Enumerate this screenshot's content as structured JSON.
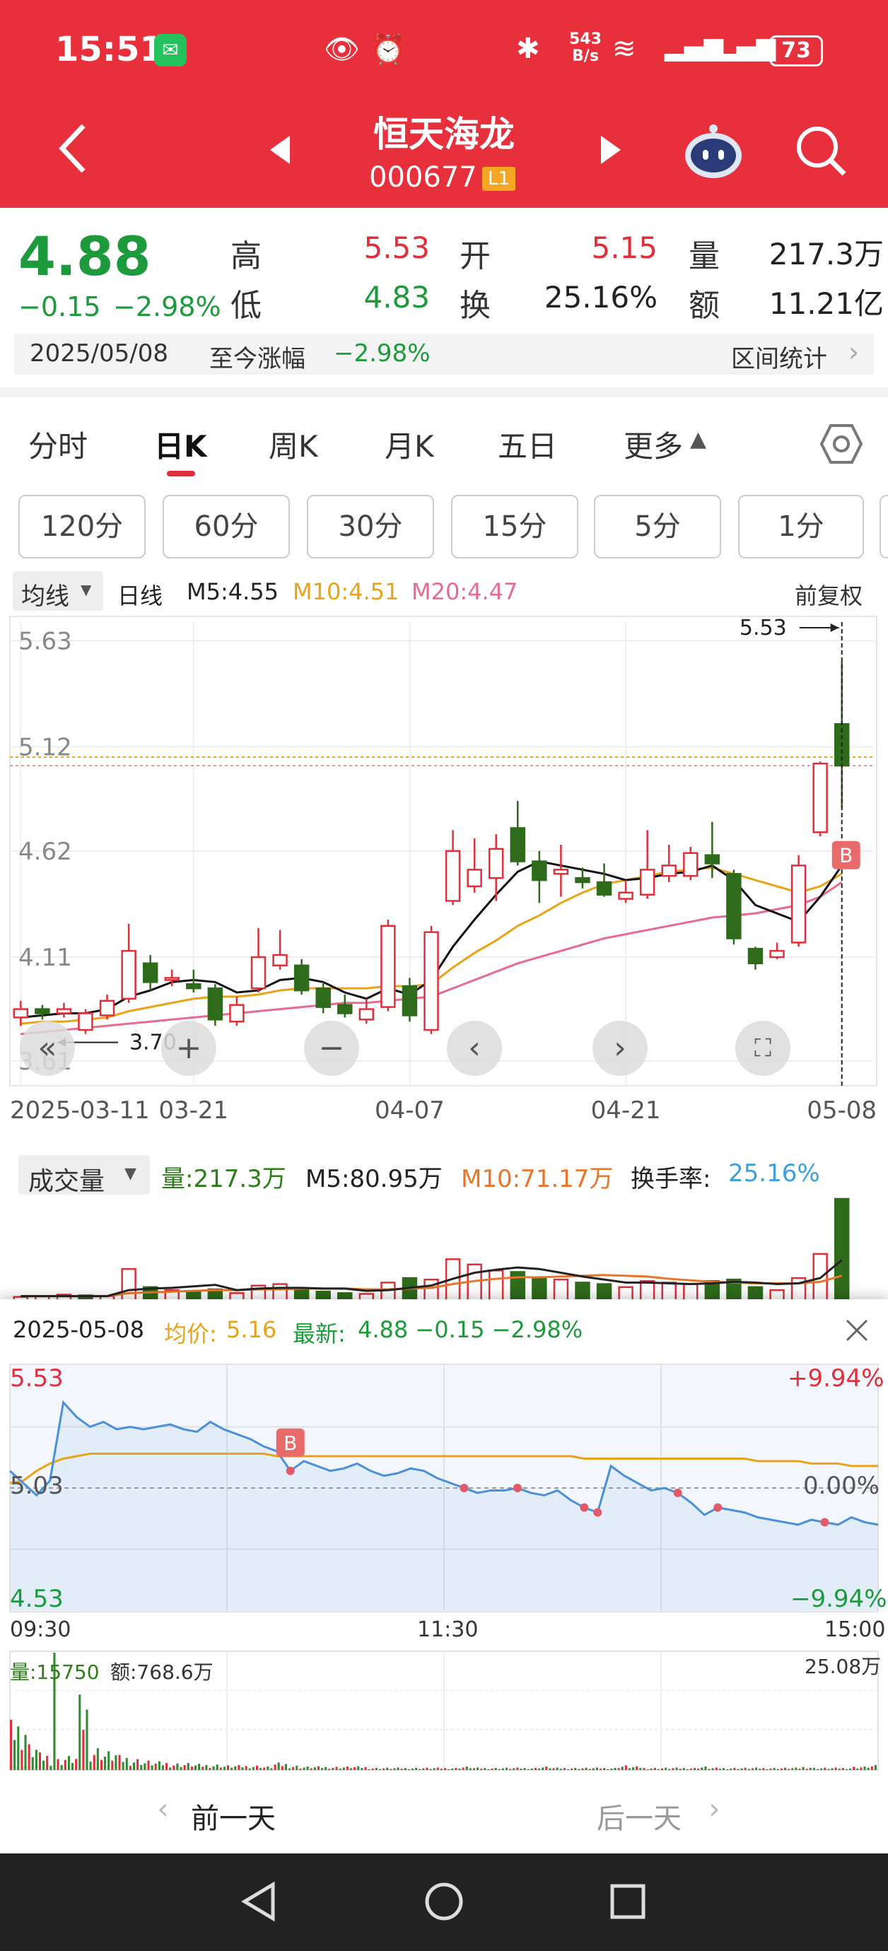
{
  "status": {
    "time": "15:51",
    "net_speed": "543",
    "net_unit": "B/s",
    "battery": "73"
  },
  "header": {
    "name": "恒天海龙",
    "code": "000677",
    "badge": "L1"
  },
  "quote": {
    "price": "4.88",
    "change": "−0.15",
    "change_pct": "−2.98%",
    "high_label": "高",
    "high": "5.53",
    "low_label": "低",
    "low": "4.83",
    "open_label": "开",
    "open": "5.15",
    "turnover_label": "换",
    "turnover": "25.16%",
    "volume_label": "量",
    "volume": "217.3万",
    "amount_label": "额",
    "amount": "11.21亿"
  },
  "range": {
    "date": "2025/05/08",
    "label": "至今涨幅",
    "value": "−2.98%",
    "stats": "区间统计"
  },
  "tabs": [
    "分时",
    "日K",
    "周K",
    "月K",
    "五日",
    "更多"
  ],
  "intervals": [
    "120分",
    "60分",
    "30分",
    "15分",
    "5分",
    "1分"
  ],
  "kline_legend": {
    "ma_select": "均线",
    "period": "日线",
    "m5": "M5:4.55",
    "m10": "M10:4.51",
    "m20": "M20:4.47",
    "adjust": "前复权"
  },
  "volume_legend": {
    "select": "成交量",
    "vol": "量:217.3万",
    "m5": "M5:80.95万",
    "m10": "M10:71.17万",
    "turnover_label": "换手率:",
    "turnover": "25.16%"
  },
  "intraday": {
    "date": "2025-05-08",
    "avg_label": "均价:",
    "avg": "5.16",
    "last_label": "最新:",
    "last": "4.88 −0.15 −2.98%",
    "high": "5.53",
    "mid": "5.03",
    "low": "4.53",
    "up_pct": "+9.94%",
    "zero_pct": "0.00%",
    "down_pct": "−9.94%",
    "t_start": "09:30",
    "t_mid": "11:30",
    "t_end": "15:00",
    "vol_label": "量:15750",
    "amt_label": "额:768.6万",
    "max_amt": "25.08万",
    "marker": "B"
  },
  "nav": {
    "prev": "前一天",
    "next": "后一天"
  },
  "colors": {
    "up": "#e02f3a",
    "down": "#2e6b1a",
    "ma5": "#111111",
    "ma10": "#e8a317",
    "ma20": "#e86a8e",
    "avg": "#e8a317",
    "price": "#4a90d9",
    "header": "#e8303c"
  },
  "chart_data": [
    {
      "type": "candlestick",
      "title": "日K",
      "y_ticks": [
        "5.63",
        "5.12",
        "4.62",
        "4.11",
        "3.61"
      ],
      "x_ticks": [
        "2025-03-11",
        "03-21",
        "04-07",
        "04-21",
        "05-08"
      ],
      "high_mark": "5.53",
      "low_mark": "3.70",
      "marker": "B",
      "ylim": [
        3.58,
        5.72
      ],
      "candles": [
        {
          "o": 3.82,
          "c": 3.86,
          "h": 3.9,
          "l": 3.78
        },
        {
          "o": 3.86,
          "c": 3.84,
          "h": 3.88,
          "l": 3.81
        },
        {
          "o": 3.84,
          "c": 3.86,
          "h": 3.89,
          "l": 3.82
        },
        {
          "o": 3.76,
          "c": 3.84,
          "h": 3.86,
          "l": 3.74
        },
        {
          "o": 3.83,
          "c": 3.9,
          "h": 3.93,
          "l": 3.81
        },
        {
          "o": 3.91,
          "c": 4.14,
          "h": 4.27,
          "l": 3.89
        },
        {
          "o": 4.08,
          "c": 3.99,
          "h": 4.12,
          "l": 3.95
        },
        {
          "o": 4.01,
          "c": 4.01,
          "h": 4.05,
          "l": 3.97
        },
        {
          "o": 3.98,
          "c": 3.96,
          "h": 4.05,
          "l": 3.94
        },
        {
          "o": 3.96,
          "c": 3.81,
          "h": 3.98,
          "l": 3.78
        },
        {
          "o": 3.8,
          "c": 3.88,
          "h": 3.92,
          "l": 3.78
        },
        {
          "o": 3.96,
          "c": 4.11,
          "h": 4.25,
          "l": 3.94
        },
        {
          "o": 4.07,
          "c": 4.12,
          "h": 4.24,
          "l": 4.05
        },
        {
          "o": 4.07,
          "c": 3.95,
          "h": 4.1,
          "l": 3.93
        },
        {
          "o": 3.96,
          "c": 3.87,
          "h": 3.99,
          "l": 3.84
        },
        {
          "o": 3.88,
          "c": 3.84,
          "h": 3.93,
          "l": 3.82
        },
        {
          "o": 3.81,
          "c": 3.86,
          "h": 3.91,
          "l": 3.79
        },
        {
          "o": 3.87,
          "c": 4.26,
          "h": 4.29,
          "l": 3.85
        },
        {
          "o": 3.97,
          "c": 3.83,
          "h": 4.01,
          "l": 3.8
        },
        {
          "o": 3.76,
          "c": 4.23,
          "h": 4.26,
          "l": 3.74
        },
        {
          "o": 4.38,
          "c": 4.62,
          "h": 4.72,
          "l": 4.36
        },
        {
          "o": 4.45,
          "c": 4.53,
          "h": 4.68,
          "l": 4.42
        },
        {
          "o": 4.49,
          "c": 4.63,
          "h": 4.7,
          "l": 4.38
        },
        {
          "o": 4.73,
          "c": 4.57,
          "h": 4.86,
          "l": 4.55
        },
        {
          "o": 4.57,
          "c": 4.48,
          "h": 4.62,
          "l": 4.37
        },
        {
          "o": 4.51,
          "c": 4.53,
          "h": 4.65,
          "l": 4.4
        },
        {
          "o": 4.49,
          "c": 4.47,
          "h": 4.54,
          "l": 4.44
        },
        {
          "o": 4.47,
          "c": 4.41,
          "h": 4.56,
          "l": 4.4
        },
        {
          "o": 4.39,
          "c": 4.42,
          "h": 4.48,
          "l": 4.37
        },
        {
          "o": 4.41,
          "c": 4.53,
          "h": 4.72,
          "l": 4.39
        },
        {
          "o": 4.5,
          "c": 4.55,
          "h": 4.65,
          "l": 4.47
        },
        {
          "o": 4.5,
          "c": 4.61,
          "h": 4.64,
          "l": 4.48
        },
        {
          "o": 4.6,
          "c": 4.56,
          "h": 4.76,
          "l": 4.49
        },
        {
          "o": 4.51,
          "c": 4.2,
          "h": 4.53,
          "l": 4.17
        },
        {
          "o": 4.15,
          "c": 4.08,
          "h": 4.16,
          "l": 4.05
        },
        {
          "o": 4.11,
          "c": 4.14,
          "h": 4.18,
          "l": 4.1
        },
        {
          "o": 4.18,
          "c": 4.55,
          "h": 4.6,
          "l": 4.16
        },
        {
          "o": 4.71,
          "c": 5.04,
          "h": 5.05,
          "l": 4.69
        },
        {
          "o": 5.23,
          "c": 5.03,
          "h": 5.53,
          "l": 4.83
        }
      ],
      "ma5": [
        3.82,
        3.83,
        3.84,
        3.84,
        3.86,
        3.92,
        3.95,
        3.99,
        4.0,
        3.99,
        3.94,
        3.95,
        4.0,
        4.01,
        3.99,
        3.94,
        3.91,
        3.96,
        3.93,
        4.0,
        4.16,
        4.29,
        4.41,
        4.52,
        4.57,
        4.55,
        4.53,
        4.51,
        4.48,
        4.49,
        4.51,
        4.52,
        4.55,
        4.48,
        4.36,
        4.32,
        4.28,
        4.4,
        4.55
      ],
      "ma10": [
        3.79,
        3.8,
        3.8,
        3.81,
        3.82,
        3.85,
        3.87,
        3.89,
        3.91,
        3.92,
        3.92,
        3.93,
        3.95,
        3.96,
        3.96,
        3.96,
        3.96,
        3.97,
        3.97,
        3.98,
        4.06,
        4.13,
        4.19,
        4.26,
        4.31,
        4.37,
        4.42,
        4.46,
        4.48,
        4.5,
        4.52,
        4.53,
        4.54,
        4.51,
        4.48,
        4.45,
        4.42,
        4.45,
        4.51
      ],
      "ma20": [
        3.74,
        3.75,
        3.76,
        3.77,
        3.78,
        3.79,
        3.8,
        3.81,
        3.82,
        3.83,
        3.84,
        3.85,
        3.86,
        3.87,
        3.88,
        3.89,
        3.89,
        3.9,
        3.91,
        3.92,
        3.96,
        4.0,
        4.04,
        4.08,
        4.11,
        4.14,
        4.17,
        4.2,
        4.22,
        4.24,
        4.26,
        4.28,
        4.3,
        4.31,
        4.32,
        4.34,
        4.36,
        4.4,
        4.47
      ]
    },
    {
      "type": "bar",
      "title": "成交量",
      "values": [
        5,
        6,
        8,
        7,
        6,
        42,
        18,
        14,
        12,
        15,
        10,
        20,
        22,
        16,
        12,
        10,
        9,
        24,
        30,
        28,
        55,
        48,
        40,
        38,
        30,
        28,
        24,
        22,
        18,
        26,
        24,
        22,
        26,
        28,
        18,
        14,
        30,
        62,
        135
      ],
      "colors": [
        "up",
        "up",
        "up",
        "down",
        "up",
        "up",
        "down",
        "up",
        "down",
        "down",
        "up",
        "up",
        "up",
        "down",
        "down",
        "down",
        "up",
        "up",
        "down",
        "up",
        "up",
        "up",
        "up",
        "down",
        "down",
        "up",
        "down",
        "down",
        "up",
        "up",
        "up",
        "up",
        "down",
        "down",
        "down",
        "up",
        "up",
        "up",
        "down"
      ],
      "ma5": [
        6,
        6,
        6,
        6,
        6,
        14,
        16,
        17,
        19,
        21,
        14,
        16,
        17,
        17,
        16,
        16,
        13,
        14,
        17,
        20,
        29,
        37,
        41,
        44,
        42,
        37,
        32,
        28,
        24,
        24,
        23,
        22,
        23,
        25,
        24,
        22,
        23,
        30,
        54
      ],
      "ma10": [
        6,
        6,
        6,
        6,
        6,
        10,
        11,
        12,
        13,
        14,
        14,
        15,
        15,
        16,
        16,
        16,
        15,
        15,
        16,
        17,
        22,
        26,
        29,
        31,
        31,
        32,
        33,
        34,
        33,
        32,
        29,
        27,
        25,
        24,
        23,
        23,
        23,
        25,
        33
      ]
    },
    {
      "type": "line",
      "title": "分时",
      "ylim": [
        4.53,
        5.53
      ],
      "base": 5.03,
      "price": [
        5.1,
        5.05,
        5.0,
        5.06,
        5.38,
        5.32,
        5.28,
        5.3,
        5.27,
        5.28,
        5.27,
        5.28,
        5.29,
        5.27,
        5.26,
        5.3,
        5.27,
        5.25,
        5.23,
        5.2,
        5.18,
        5.1,
        5.14,
        5.12,
        5.1,
        5.11,
        5.13,
        5.1,
        5.08,
        5.09,
        5.11,
        5.1,
        5.07,
        5.05,
        5.03,
        5.01,
        5.02,
        5.02,
        5.03,
        5.01,
        5.0,
        5.02,
        4.98,
        4.95,
        4.93,
        5.12,
        5.08,
        5.05,
        5.02,
        5.03,
        5.01,
        4.97,
        4.92,
        4.95,
        4.94,
        4.93,
        4.91,
        4.9,
        4.89,
        4.88,
        4.9,
        4.89,
        4.88,
        4.91,
        4.89,
        4.88
      ],
      "avg": [
        5.05,
        5.06,
        5.1,
        5.13,
        5.15,
        5.16,
        5.17,
        5.17,
        5.17,
        5.17,
        5.17,
        5.17,
        5.17,
        5.17,
        5.17,
        5.17,
        5.17,
        5.17,
        5.17,
        5.17,
        5.16,
        5.16,
        5.16,
        5.16,
        5.16,
        5.16,
        5.16,
        5.16,
        5.16,
        5.16,
        5.16,
        5.16,
        5.16,
        5.16,
        5.16,
        5.16,
        5.16,
        5.16,
        5.16,
        5.16,
        5.16,
        5.16,
        5.16,
        5.15,
        5.15,
        5.15,
        5.15,
        5.15,
        5.15,
        5.15,
        5.15,
        5.15,
        5.15,
        5.15,
        5.15,
        5.15,
        5.14,
        5.14,
        5.14,
        5.14,
        5.13,
        5.13,
        5.13,
        5.12,
        5.12,
        5.12
      ],
      "volume": [
        40,
        22,
        14,
        10,
        12,
        60,
        20,
        16,
        12,
        10,
        8,
        7,
        6,
        6,
        5,
        5,
        4,
        4,
        4,
        3,
        6,
        4,
        3,
        3,
        3,
        3,
        3,
        2,
        2,
        2,
        2,
        2,
        2,
        2,
        3,
        2,
        2,
        2,
        2,
        2,
        3,
        2,
        2,
        2,
        2,
        2,
        4,
        3,
        2,
        2,
        2,
        2,
        3,
        2,
        2,
        2,
        2,
        2,
        2,
        2,
        3,
        2,
        2,
        2,
        3,
        4
      ]
    }
  ]
}
